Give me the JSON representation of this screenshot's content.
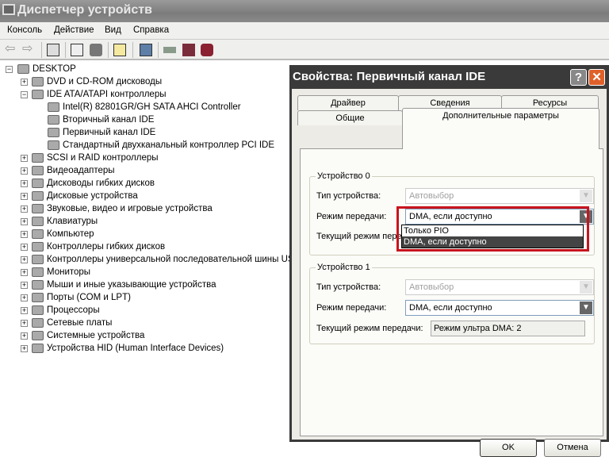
{
  "window": {
    "title": "Диспетчер устройств"
  },
  "menu": [
    "Консоль",
    "Действие",
    "Вид",
    "Справка"
  ],
  "toolbar_icons": [
    "back-icon",
    "forward-icon",
    "show-hide-tree-icon",
    "properties-icon",
    "print-icon",
    "help-icon",
    "scan-hardware-icon",
    "update-driver-icon",
    "disable-device-icon",
    "uninstall-device-icon"
  ],
  "tree": {
    "root": "DESKTOP",
    "items": [
      {
        "label": "DVD и CD-ROM дисководы",
        "level": 1,
        "exp": "+"
      },
      {
        "label": "IDE ATA/ATAPI контроллеры",
        "level": 1,
        "exp": "-"
      },
      {
        "label": "Intel(R) 82801GR/GH SATA AHCI Controller",
        "level": 2
      },
      {
        "label": "Вторичный канал IDE",
        "level": 2
      },
      {
        "label": "Первичный канал IDE",
        "level": 2
      },
      {
        "label": "Стандартный двухканальный контроллер PCI IDE",
        "level": 2
      },
      {
        "label": "SCSI и RAID контроллеры",
        "level": 1,
        "exp": "+"
      },
      {
        "label": "Видеоадаптеры",
        "level": 1,
        "exp": "+"
      },
      {
        "label": "Дисководы гибких дисков",
        "level": 1,
        "exp": "+"
      },
      {
        "label": "Дисковые устройства",
        "level": 1,
        "exp": "+"
      },
      {
        "label": "Звуковые, видео и игровые устройства",
        "level": 1,
        "exp": "+"
      },
      {
        "label": "Клавиатуры",
        "level": 1,
        "exp": "+"
      },
      {
        "label": "Компьютер",
        "level": 1,
        "exp": "+"
      },
      {
        "label": "Контроллеры гибких дисков",
        "level": 1,
        "exp": "+"
      },
      {
        "label": "Контроллеры универсальной последовательной шины USB",
        "level": 1,
        "exp": "+"
      },
      {
        "label": "Мониторы",
        "level": 1,
        "exp": "+"
      },
      {
        "label": "Мыши и иные указывающие устройства",
        "level": 1,
        "exp": "+"
      },
      {
        "label": "Порты (COM и LPT)",
        "level": 1,
        "exp": "+"
      },
      {
        "label": "Процессоры",
        "level": 1,
        "exp": "+"
      },
      {
        "label": "Сетевые платы",
        "level": 1,
        "exp": "+"
      },
      {
        "label": "Системные устройства",
        "level": 1,
        "exp": "+"
      },
      {
        "label": "Устройства HID (Human Interface Devices)",
        "level": 1,
        "exp": "+"
      }
    ]
  },
  "dialog": {
    "title": "Свойства: Первичный канал IDE",
    "help": "?",
    "close": "✕",
    "tabs_row1": [
      "Драйвер",
      "Сведения",
      "Ресурсы"
    ],
    "tabs_row2": [
      "Общие",
      "Дополнительные параметры"
    ],
    "active_tab": "Дополнительные параметры",
    "device0": {
      "legend": "Устройство 0",
      "type_label": "Тип устройства:",
      "type_value": "Автовыбор",
      "mode_label": "Режим передачи:",
      "mode_value": "DMA, если доступно",
      "current_label": "Текущий режим передачи:",
      "dropdown_options": [
        "Только PIO",
        "DMA, если доступно"
      ],
      "dropdown_selected": "DMA, если доступно"
    },
    "device1": {
      "legend": "Устройство 1",
      "type_label": "Тип устройства:",
      "type_value": "Автовыбор",
      "mode_label": "Режим передачи:",
      "mode_value": "DMA, если доступно",
      "current_label": "Текущий режим передачи:",
      "current_value": "Режим ультра DMA: 2"
    },
    "ok": "OK",
    "cancel": "Отмена",
    "highlight_color": "#c8141e"
  }
}
